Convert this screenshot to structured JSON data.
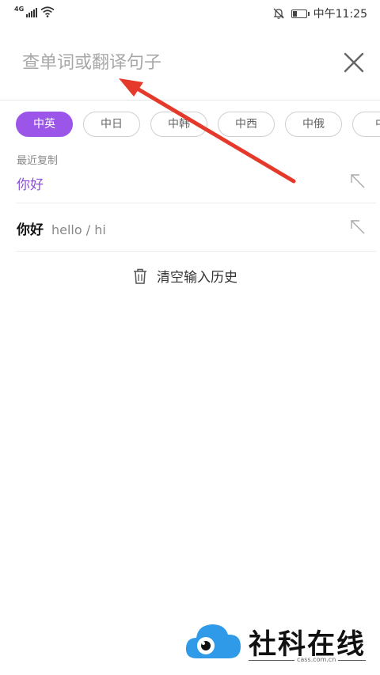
{
  "status_bar": {
    "network": "4G",
    "time": "中午11:25",
    "icons": [
      "signal-icon",
      "wifi-icon",
      "mute-bell-icon",
      "battery-icon"
    ]
  },
  "search": {
    "placeholder": "查单词或翻译句子",
    "value": "",
    "close_icon": "close-icon"
  },
  "language_tabs": [
    {
      "label": "中英",
      "selected": true
    },
    {
      "label": "中日",
      "selected": false
    },
    {
      "label": "中韩",
      "selected": false
    },
    {
      "label": "中西",
      "selected": false
    },
    {
      "label": "中俄",
      "selected": false
    },
    {
      "label": "中",
      "selected": false
    }
  ],
  "recent_copy": {
    "label": "最近复制",
    "word": "你好"
  },
  "history": [
    {
      "word": "你好",
      "definition": "hello / hi"
    }
  ],
  "clear_history": {
    "label": "清空输入历史",
    "icon": "trash-icon"
  },
  "watermark": {
    "text": "社科在线",
    "domain": "cass.com.cn"
  },
  "colors": {
    "accent": "#9b55e8",
    "recent_word": "#8a4fd6",
    "annotation_arrow": "#e53a2b",
    "watermark_blue": "#2f9be8"
  }
}
